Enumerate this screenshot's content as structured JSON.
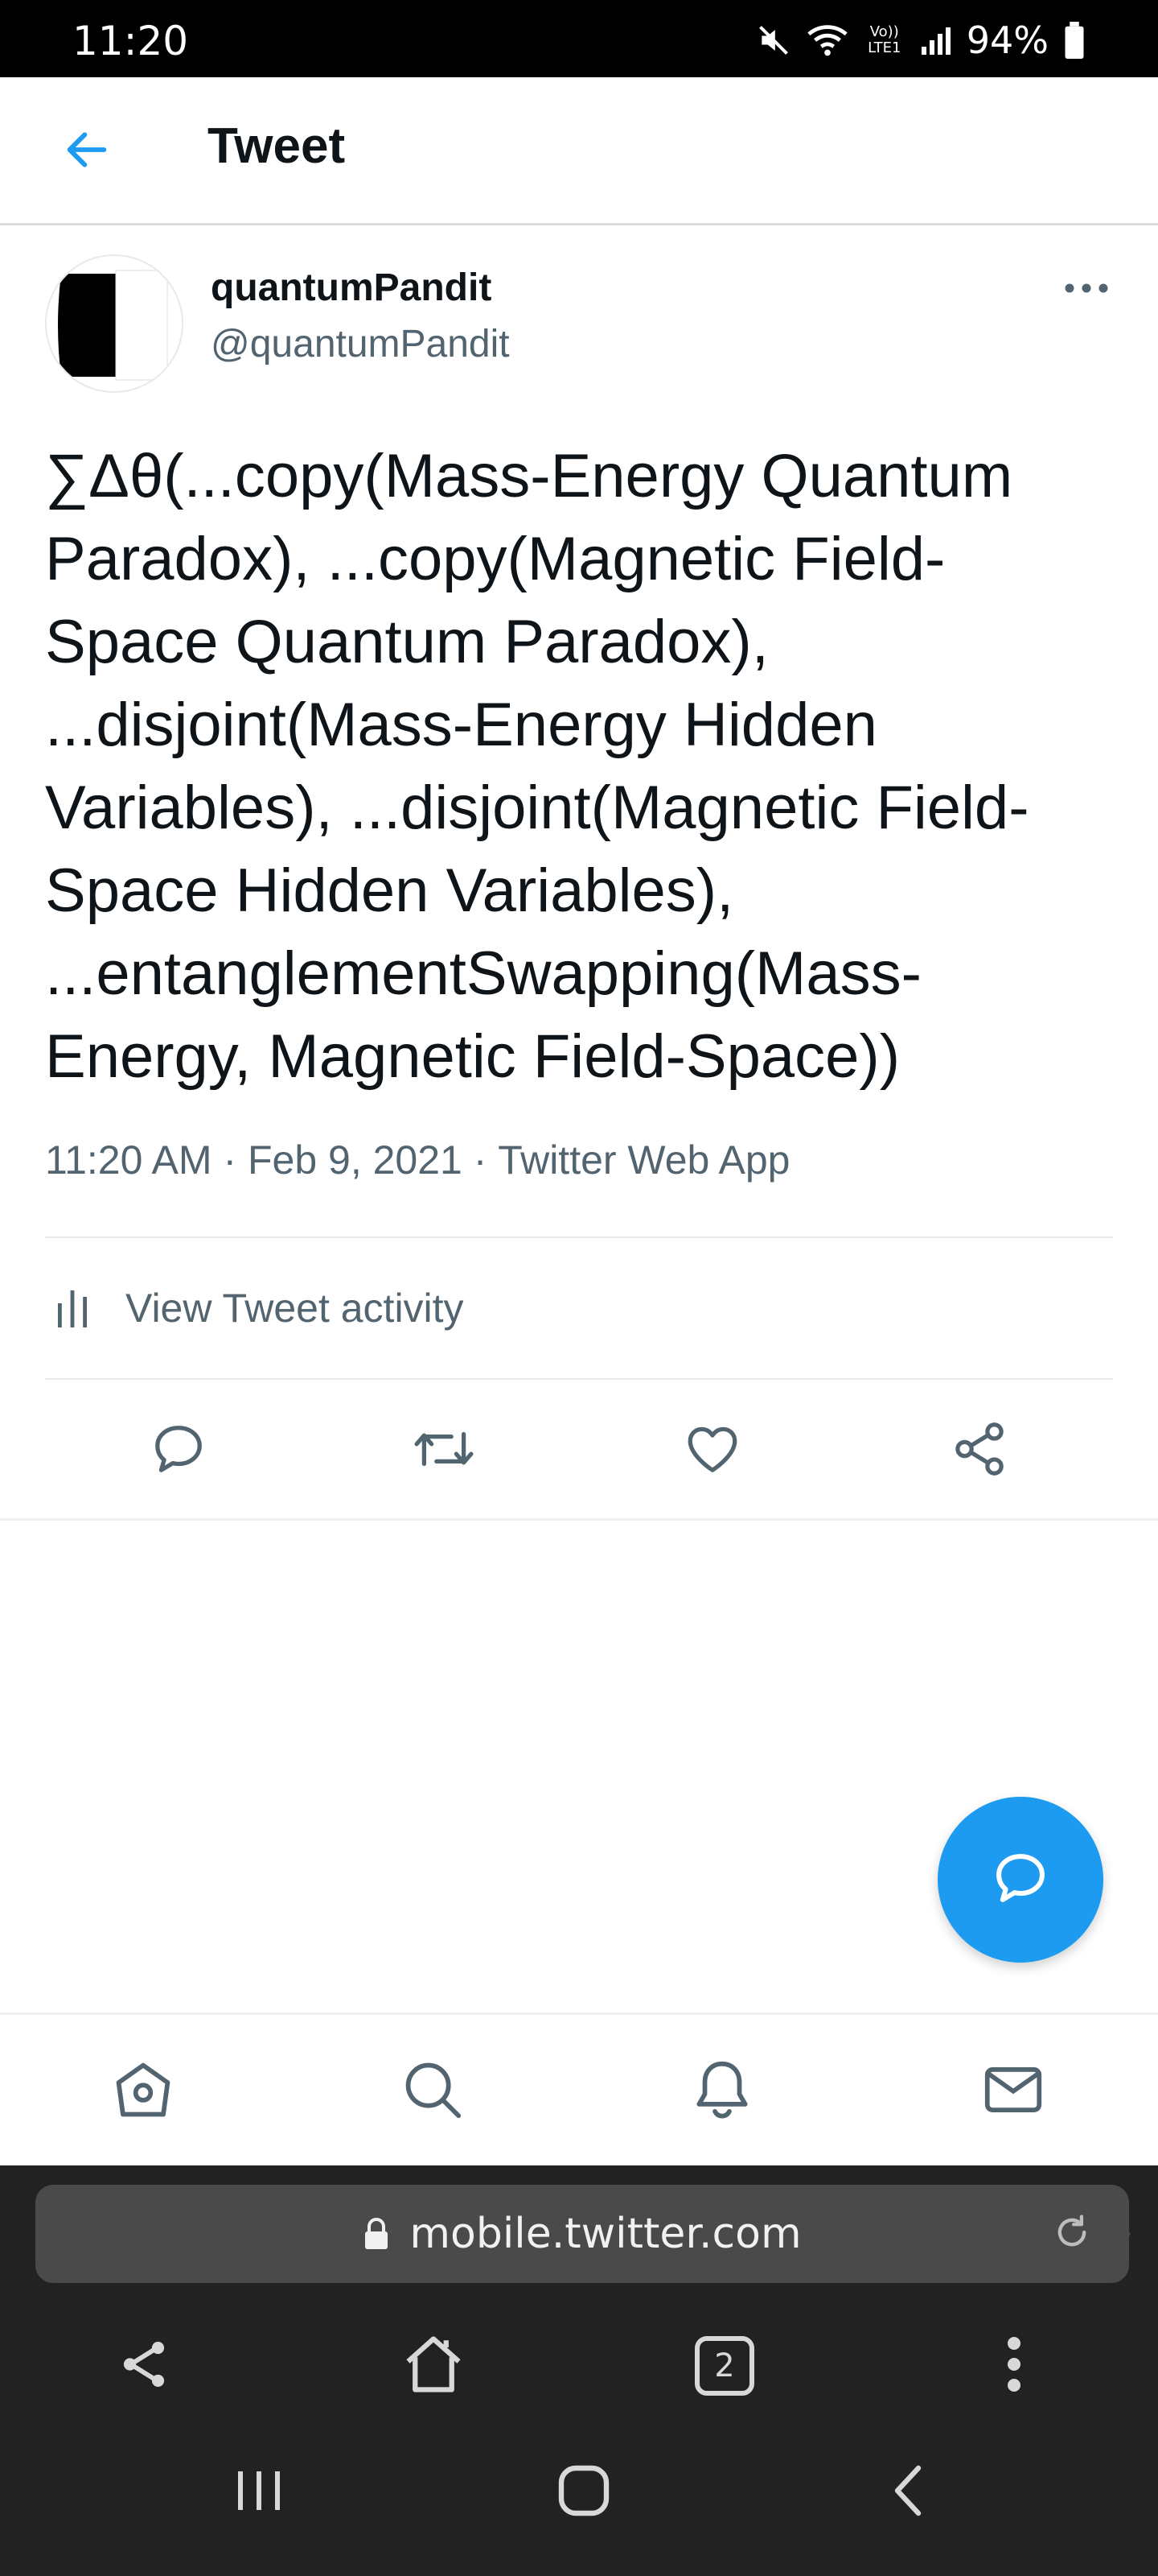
{
  "status_bar": {
    "time": "11:20",
    "battery": "94%",
    "network_label": "Vo)) LTE1",
    "icons": [
      "mute-icon",
      "wifi-icon",
      "signal-icon",
      "battery-icon"
    ]
  },
  "header": {
    "title": "Tweet",
    "back_icon": "arrow-left-icon"
  },
  "tweet": {
    "display_name": "quantumPandit",
    "handle": "@quantumPandit",
    "text": "∑Δθ(...copy(Mass-Energy Quantum\nParadox), ...copy(Magnetic Field-\nSpace Quantum Paradox),\n...disjoint(Mass-Energy Hidden\nVariables), ...disjoint(Magnetic Field-\nSpace Hidden Variables),\n...entanglementSwapping(Mass-\nEnergy, Magnetic Field-Space))",
    "time": "11:20 AM",
    "separator": " · ",
    "date": "Feb 9, 2021",
    "source": "Twitter Web App",
    "activity_label": "View Tweet activity"
  },
  "actions": [
    "reply-icon",
    "retweet-icon",
    "like-icon",
    "share-icon"
  ],
  "bottom_nav": [
    "home-icon",
    "search-icon",
    "notifications-icon",
    "messages-icon"
  ],
  "browser": {
    "url": "mobile.twitter.com",
    "tab_count": "2"
  },
  "colors": {
    "accent": "#1d9bf0",
    "text": "#0f1419",
    "secondary": "#536471",
    "browser_bg": "#222222"
  }
}
